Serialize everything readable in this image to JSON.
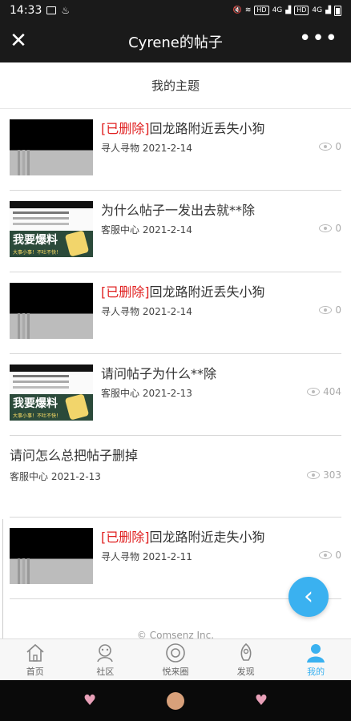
{
  "status_bar": {
    "time": "14:33",
    "network_badges": [
      "HD",
      "4G",
      "HD",
      "4G"
    ]
  },
  "nav": {
    "title": "Cyrene的帖子",
    "close_glyph": "✕",
    "more_glyph": "•••"
  },
  "section_title": "我的主题",
  "posts": [
    {
      "deleted_tag": "[已删除]",
      "title": "回龙路附近丢失小狗",
      "meta": "寻人寻物 2021-2-14",
      "views": "0",
      "thumb": "black"
    },
    {
      "deleted_tag": "",
      "title": "为什么帖子一发出去就**除",
      "meta": "客服中心 2021-2-14",
      "views": "0",
      "thumb": "screenshot"
    },
    {
      "deleted_tag": "[已删除]",
      "title": "回龙路附近丢失小狗",
      "meta": "寻人寻物 2021-2-14",
      "views": "0",
      "thumb": "black"
    },
    {
      "deleted_tag": "",
      "title": "请问帖子为什么**除",
      "meta": "客服中心 2021-2-13",
      "views": "404",
      "thumb": "screenshot"
    },
    {
      "deleted_tag": "",
      "title": "请问怎么总把帖子删掉",
      "meta": "客服中心 2021-2-13",
      "views": "303",
      "thumb": "none"
    },
    {
      "deleted_tag": "[已删除]",
      "title": "回龙路附近走失小狗",
      "meta": "寻人寻物 2021-2-11",
      "views": "0",
      "thumb": "black"
    }
  ],
  "thumb_screenshot": {
    "banner": "我要爆料",
    "sub": "大事小事！不吐不快！"
  },
  "copyright": "© Comsenz Inc.",
  "fab_glyph": "‹",
  "tabs": [
    {
      "label": "首页",
      "icon": "home-icon",
      "active": false
    },
    {
      "label": "社区",
      "icon": "community-icon",
      "active": false
    },
    {
      "label": "悦来圈",
      "icon": "circle-icon",
      "active": false
    },
    {
      "label": "发现",
      "icon": "discover-icon",
      "active": false
    },
    {
      "label": "我的",
      "icon": "profile-icon",
      "active": true
    }
  ],
  "colors": {
    "accent": "#3ab1f0",
    "deleted": "#e02020",
    "nav_bg": "#1a1a1a"
  }
}
